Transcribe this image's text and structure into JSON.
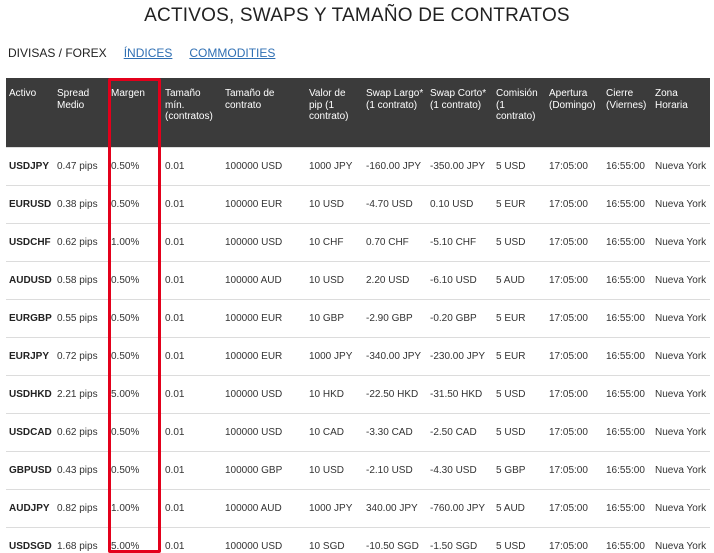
{
  "page": {
    "title": "ACTIVOS, SWAPS Y TAMAÑO DE CONTRATOS"
  },
  "tabs": [
    {
      "label": "DIVISAS / FOREX",
      "active": true
    },
    {
      "label": "ÍNDICES",
      "active": false
    },
    {
      "label": "COMMODITIES",
      "active": false
    }
  ],
  "table": {
    "headers": [
      "Activo",
      "Spread Medio",
      "Margen",
      "Tamaño mín. (contratos)",
      "Tamaño de contrato",
      "Valor de pip (1 contrato)",
      "Swap Largo* (1 contrato)",
      "Swap Corto* (1 contrato)",
      "Comisión (1 contrato)",
      "Apertura (Domingo)",
      "Cierre (Viernes)",
      "Zona Horaria"
    ],
    "rows": [
      [
        "USDJPY",
        "0.47 pips",
        "0.50%",
        "0.01",
        "100000 USD",
        "1000 JPY",
        "-160.00 JPY",
        "-350.00 JPY",
        "5 USD",
        "17:05:00",
        "16:55:00",
        "Nueva York"
      ],
      [
        "EURUSD",
        "0.38 pips",
        "0.50%",
        "0.01",
        "100000 EUR",
        "10 USD",
        "-4.70 USD",
        "0.10 USD",
        "5 EUR",
        "17:05:00",
        "16:55:00",
        "Nueva York"
      ],
      [
        "USDCHF",
        "0.62 pips",
        "1.00%",
        "0.01",
        "100000 USD",
        "10 CHF",
        "0.70 CHF",
        "-5.10 CHF",
        "5 USD",
        "17:05:00",
        "16:55:00",
        "Nueva York"
      ],
      [
        "AUDUSD",
        "0.58 pips",
        "0.50%",
        "0.01",
        "100000 AUD",
        "10 USD",
        "2.20 USD",
        "-6.10 USD",
        "5 AUD",
        "17:05:00",
        "16:55:00",
        "Nueva York"
      ],
      [
        "EURGBP",
        "0.55 pips",
        "0.50%",
        "0.01",
        "100000 EUR",
        "10 GBP",
        "-2.90 GBP",
        "-0.20 GBP",
        "5 EUR",
        "17:05:00",
        "16:55:00",
        "Nueva York"
      ],
      [
        "EURJPY",
        "0.72 pips",
        "0.50%",
        "0.01",
        "100000 EUR",
        "1000 JPY",
        "-340.00 JPY",
        "-230.00 JPY",
        "5 EUR",
        "17:05:00",
        "16:55:00",
        "Nueva York"
      ],
      [
        "USDHKD",
        "2.21 pips",
        "5.00%",
        "0.01",
        "100000 USD",
        "10 HKD",
        "-22.50 HKD",
        "-31.50 HKD",
        "5 USD",
        "17:05:00",
        "16:55:00",
        "Nueva York"
      ],
      [
        "USDCAD",
        "0.62 pips",
        "0.50%",
        "0.01",
        "100000 USD",
        "10 CAD",
        "-3.30 CAD",
        "-2.50 CAD",
        "5 USD",
        "17:05:00",
        "16:55:00",
        "Nueva York"
      ],
      [
        "GBPUSD",
        "0.43 pips",
        "0.50%",
        "0.01",
        "100000 GBP",
        "10 USD",
        "-2.10 USD",
        "-4.30 USD",
        "5 GBP",
        "17:05:00",
        "16:55:00",
        "Nueva York"
      ],
      [
        "AUDJPY",
        "0.82 pips",
        "1.00%",
        "0.01",
        "100000 AUD",
        "1000 JPY",
        "340.00 JPY",
        "-760.00 JPY",
        "5 AUD",
        "17:05:00",
        "16:55:00",
        "Nueva York"
      ],
      [
        "USDSGD",
        "1.68 pips",
        "5.00%",
        "0.01",
        "100000 USD",
        "10 SGD",
        "-10.50 SGD",
        "-1.50 SGD",
        "5 USD",
        "17:05:00",
        "16:55:00",
        "Nueva York"
      ]
    ]
  },
  "colors": {
    "header_background": "#3b3b3b",
    "link": "#2f6fb3",
    "highlight_border": "#e3001b"
  }
}
